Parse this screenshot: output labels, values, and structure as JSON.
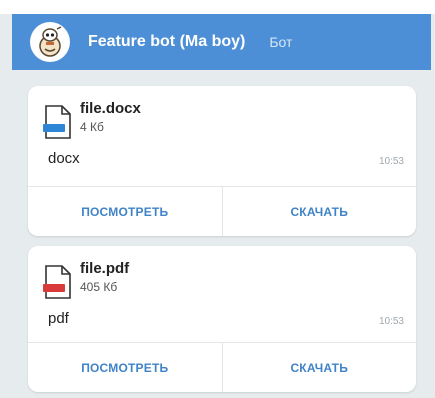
{
  "header": {
    "bot_name": "Feature bot (Ma boy)",
    "bot_label": "Бот",
    "avatar_icon": "cartoon-bot-avatar"
  },
  "messages": [
    {
      "file_name": "file.docx",
      "file_size": "4 Кб",
      "file_icon": "docx-file-icon",
      "icon_color": "#2f86d6",
      "caption": "docx",
      "time": "10:53",
      "view_label": "ПОСМОТРЕТЬ",
      "download_label": "СКАЧАТЬ"
    },
    {
      "file_name": "file.pdf",
      "file_size": "405 Кб",
      "file_icon": "pdf-file-icon",
      "icon_color": "#d93a3a",
      "caption": "pdf",
      "time": "10:53",
      "view_label": "ПОСМОТРЕТЬ",
      "download_label": "СКАЧАТЬ"
    }
  ],
  "colors": {
    "header": "#4d8fd6",
    "action_text": "#3f83c8",
    "feed_background": "#e6ebee"
  }
}
